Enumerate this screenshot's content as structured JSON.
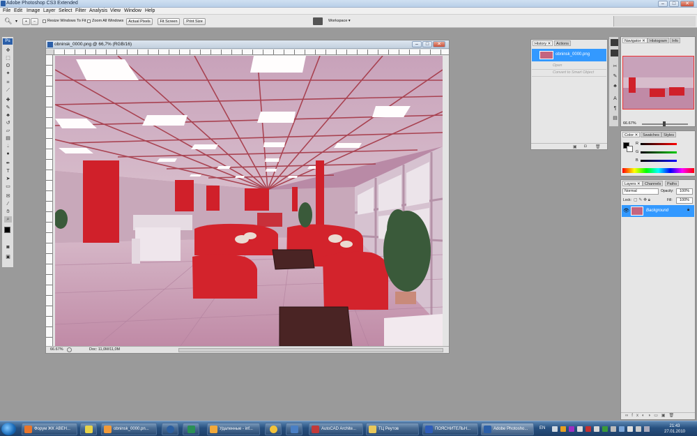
{
  "app": {
    "title": "Adobe Photoshop CS3 Extended",
    "logo": "Ps"
  },
  "menu": [
    "File",
    "Edit",
    "Image",
    "Layer",
    "Select",
    "Filter",
    "Analysis",
    "View",
    "Window",
    "Help"
  ],
  "options": {
    "resize_windows": "Resize Windows To Fit",
    "zoom_all": "Zoom All Windows",
    "actual_pixels": "Actual Pixels",
    "fit_screen": "Fit Screen",
    "print_size": "Print Size",
    "workspace": "Workspace ▾"
  },
  "document": {
    "title": "obninsk_0000.png @ 66,7% (RGB/16)",
    "zoom": "66.67%",
    "doc_info": "Doc: 11,0M/11,0M"
  },
  "history": {
    "tabs": [
      "History",
      "Actions"
    ],
    "snapshot": "obninsk_0000.png",
    "items": [
      "Open",
      "Convert to Smart Object"
    ]
  },
  "navigator": {
    "tabs": [
      "Navigator",
      "Histogram",
      "Info"
    ],
    "zoom": "66.67%"
  },
  "color": {
    "tabs": [
      "Color",
      "Swatches",
      "Styles"
    ],
    "channels": [
      "R",
      "G",
      "B"
    ]
  },
  "layers": {
    "tabs": [
      "Layers",
      "Channels",
      "Paths"
    ],
    "blend_mode": "Normal",
    "opacity_label": "Opacity:",
    "opacity": "100%",
    "lock_label": "Lock:",
    "fill_label": "Fill:",
    "fill": "100%",
    "layer_name": "Background"
  },
  "taskbar": {
    "items": [
      {
        "label": "Форум ЖК АВЕН...",
        "color": "#e8762b"
      },
      {
        "label": "",
        "color": "#e7d24a"
      },
      {
        "label": "obninsk_0000.pn...",
        "color": "#f09a3a"
      },
      {
        "label": "",
        "color": "#2c5fa0"
      },
      {
        "label": "",
        "color": "#2a8f55"
      },
      {
        "label": "Удаленные - inf...",
        "color": "#f2a93b"
      },
      {
        "label": "",
        "color": "#f2c23a"
      },
      {
        "label": "",
        "color": "#4a7fc4"
      },
      {
        "label": "AutoCAD Archite...",
        "color": "#c23a3a"
      },
      {
        "label": "ТЦ Реутов",
        "color": "#e9c85a"
      },
      {
        "label": "ПОЯСНИТЕЛЬН...",
        "color": "#2f5db8"
      },
      {
        "label": "Adobe Photosho...",
        "color": "#2b5fa8"
      }
    ],
    "lang": "EN",
    "time": "21:43",
    "date": "27.01.2010"
  },
  "colors": {
    "accent": "#3399ff",
    "interior_red": "#d0202a",
    "canvas": "#b98aa6"
  }
}
